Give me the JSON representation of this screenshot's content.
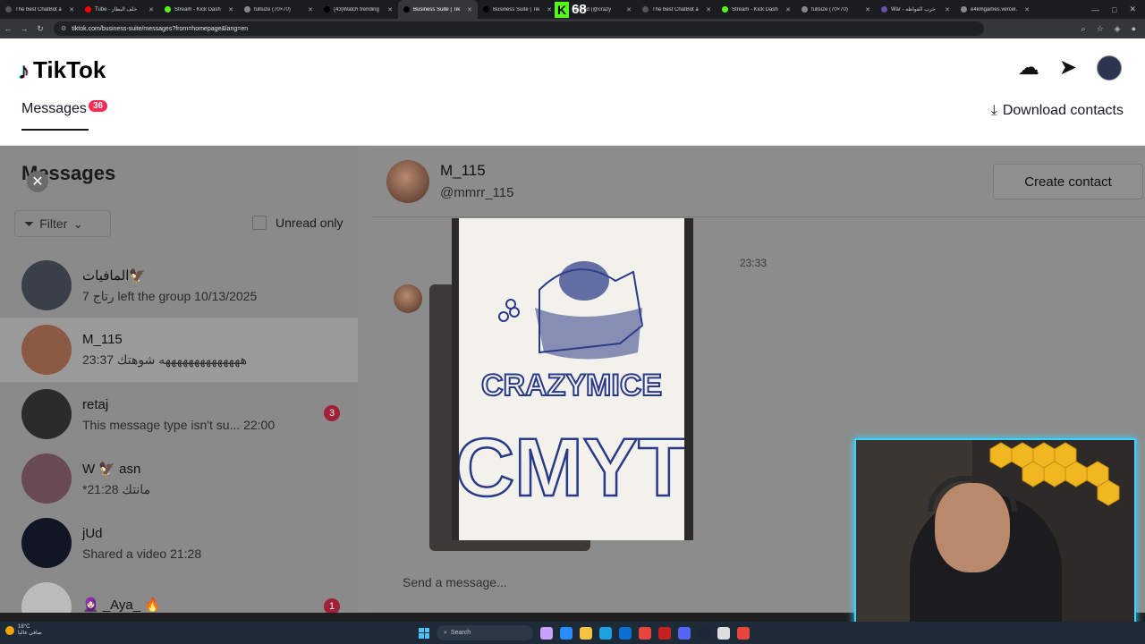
{
  "browser": {
    "tabs": [
      {
        "title": "The best ChatBot a",
        "color": "#555555"
      },
      {
        "title": "Tube - خلف البطار",
        "color": "#ff0000"
      },
      {
        "title": "Stream - Kick Dash",
        "color": "#53fc18"
      },
      {
        "title": "fullsize (70×70)",
        "color": "#888888"
      },
      {
        "title": "(43)Watch trending",
        "color": "#000000"
      },
      {
        "title": "Business Suite | Tik",
        "color": "#000000",
        "active": true
      },
      {
        "title": "Business Suite | Tik",
        "color": "#000000"
      },
      {
        "title": "Ahmad (@crazy",
        "color": "#000000"
      },
      {
        "title": "The best ChatBot a",
        "color": "#555555"
      },
      {
        "title": "Stream - Kick Dash",
        "color": "#53fc18"
      },
      {
        "title": "fullsize (70×70)",
        "color": "#888888"
      },
      {
        "title": "War - حرب القواطه",
        "color": "#6a4fb0"
      },
      {
        "title": "e4kmgames.vercel.",
        "color": "#888888"
      }
    ],
    "kick_viewers": "68",
    "url": "tiktok.com/business-suite/messages?from=homepage&lang=en"
  },
  "header": {
    "brand": "TikTok",
    "tab_label": "Messages",
    "tab_badge": "36",
    "download_label": "Download contacts"
  },
  "sidebar": {
    "title": "Messages",
    "filter_label": "Filter",
    "unread_label": "Unread only",
    "conversations": [
      {
        "name": "المافيات🦅",
        "preview": "7 رتاج left the group 10/13/2025",
        "avatar_color": "#3a3f4a",
        "count": ""
      },
      {
        "name": "M_115",
        "preview": "ههههههههههههههه شوهتك 23:37",
        "avatar_color": "#8a5a44",
        "count": "",
        "active": true
      },
      {
        "name": "retaj",
        "preview": "This message type isn't su... 22:00",
        "avatar_color": "#2b2b2b",
        "count": "3"
      },
      {
        "name": "W 🦅 asn",
        "preview": "*مانتك 21:28",
        "avatar_color": "#6a4a52",
        "count": ""
      },
      {
        "name": "jUd",
        "preview": "Shared a video 21:28",
        "avatar_color": "#121624",
        "count": ""
      },
      {
        "name": "🧕🏻 _Aya_ 🔥",
        "preview": "",
        "avatar_color": "#bbbbbb",
        "count": "1"
      }
    ]
  },
  "chat": {
    "name": "M_115",
    "handle": "@mmrr_115",
    "create_contact": "Create contact",
    "timestamp": "23:33",
    "composer_placeholder": "Send a message...",
    "drawing_text_top": "CRAZYMICE",
    "drawing_text_bottom": "CMYT"
  },
  "taskbar": {
    "temp": "18°C",
    "weather": "صافي غالبا",
    "search": "Search"
  }
}
